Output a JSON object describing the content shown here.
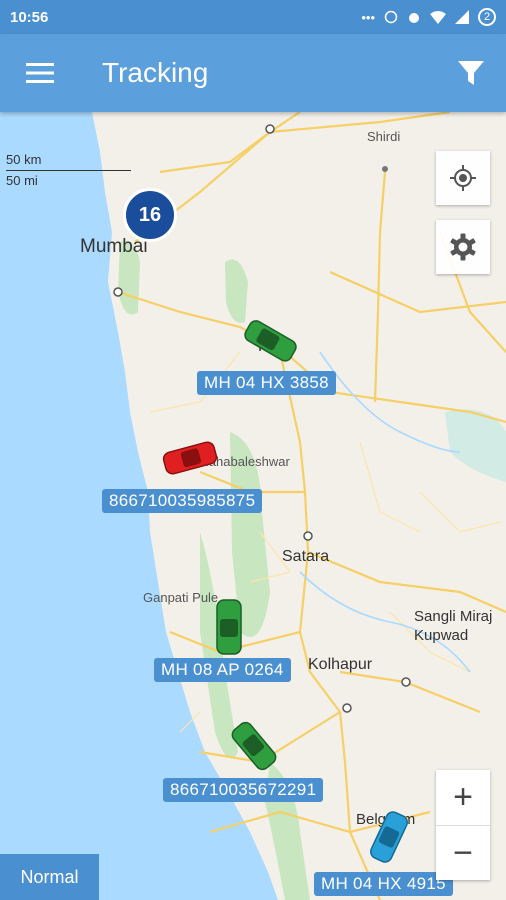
{
  "status": {
    "time": "10:56",
    "battery": "2"
  },
  "appbar": {
    "title": "Tracking"
  },
  "map": {
    "scale_km": "50 km",
    "scale_mi": "50 mi",
    "cluster_count": "16",
    "places": {
      "mumbai": "Mumbai",
      "shirdi": "Shirdi",
      "pune": "Pune",
      "mahabaleshwar": "Mahabaleshwar",
      "satara": "Satara",
      "ganpatipule": "Ganpati Pule",
      "kolhapur": "Kolhapur",
      "sangli": "Sangli Miraj",
      "kupwad": "Kupwad",
      "belgaum": "Belgaum"
    },
    "vehicles": [
      {
        "label": "MH 04 HX 3858",
        "color": "#2e9e3f"
      },
      {
        "label": "866710035985875",
        "color": "#e02020"
      },
      {
        "label": "MH 08 AP 0264",
        "color": "#2e9e3f"
      },
      {
        "label": "866710035672291",
        "color": "#2e9e3f"
      },
      {
        "label": "MH 04 HX 4915",
        "color": "#2aa0d8"
      }
    ]
  },
  "controls": {
    "zoom_in": "+",
    "zoom_out": "−",
    "map_type": "Normal"
  }
}
